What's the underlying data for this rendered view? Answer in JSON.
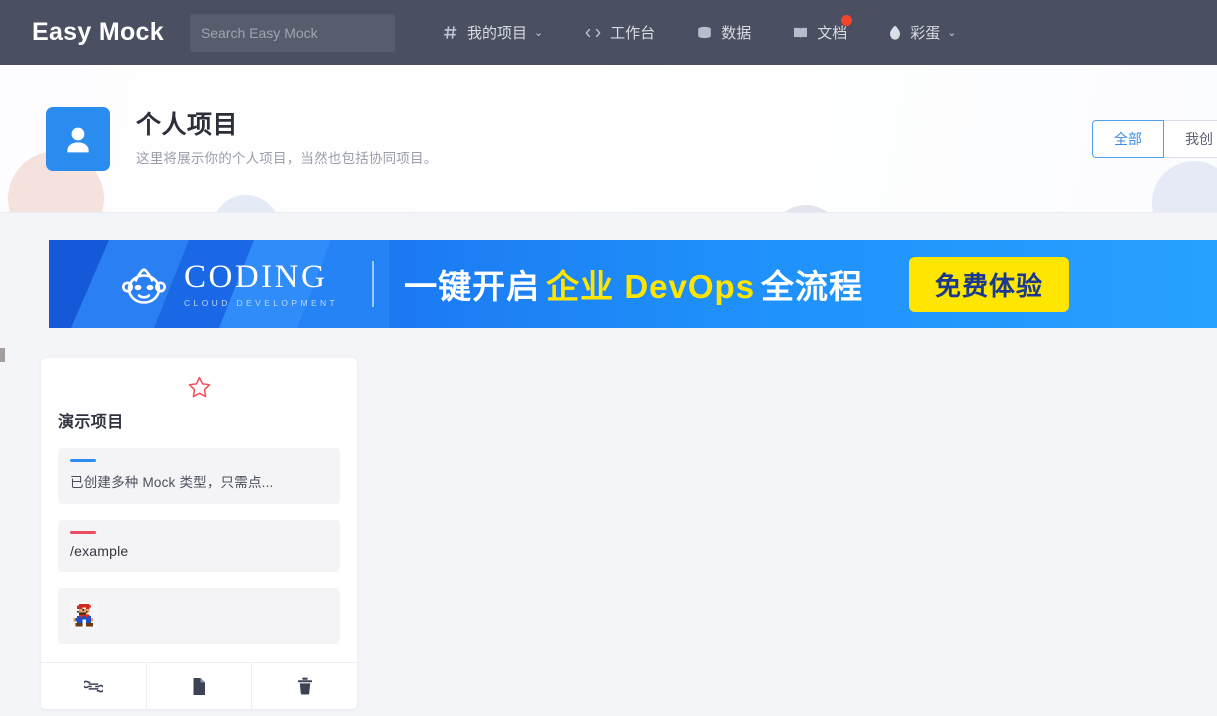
{
  "navbar": {
    "brand": "Easy Mock",
    "search_placeholder": "Search Easy Mock",
    "search_value": "",
    "items": [
      {
        "label": "我的项目",
        "icon": "hash-icon",
        "caret": "⌄",
        "badge": false
      },
      {
        "label": "工作台",
        "icon": "code-brackets-icon",
        "caret": "",
        "badge": false
      },
      {
        "label": "数据",
        "icon": "database-icon",
        "caret": "",
        "badge": false
      },
      {
        "label": "文档",
        "icon": "book-icon",
        "caret": "",
        "badge": true
      },
      {
        "label": "彩蛋",
        "icon": "egg-icon",
        "caret": "⌄",
        "badge": false
      }
    ]
  },
  "page_header": {
    "avatar_icon": "user-icon",
    "title": "个人项目",
    "subtitle": "这里将展示你的个人项目，当然也包括协同项目。",
    "filters": [
      {
        "label": "全部",
        "active": true
      },
      {
        "label": "我创",
        "active": false
      }
    ]
  },
  "banner": {
    "logo_text": "CODING",
    "logo_sub": "CLOUD DEVELOPMENT",
    "headline_part1": "一键开启",
    "headline_highlight": "企业 DevOps",
    "headline_part2": "全流程",
    "cta_label": "免费体验"
  },
  "project_card": {
    "star_icon": "star-outline-icon",
    "title": "演示项目",
    "description": "已创建多种 Mock 类型，只需点...",
    "base_path": "/example",
    "member_avatar_alt": "mario-sprite-avatar",
    "actions": [
      {
        "name": "copy-link",
        "icon": "link-icon"
      },
      {
        "name": "clone-project",
        "icon": "document-icon"
      },
      {
        "name": "delete-project",
        "icon": "trash-icon"
      }
    ]
  },
  "colors": {
    "navbar_bg": "#4a4f61",
    "accent_blue": "#2d8cf0",
    "accent_red": "#ed4c60",
    "banner_blue": "#1f90fb",
    "cta_yellow": "#ffe600",
    "badge_red": "#f2442b"
  }
}
